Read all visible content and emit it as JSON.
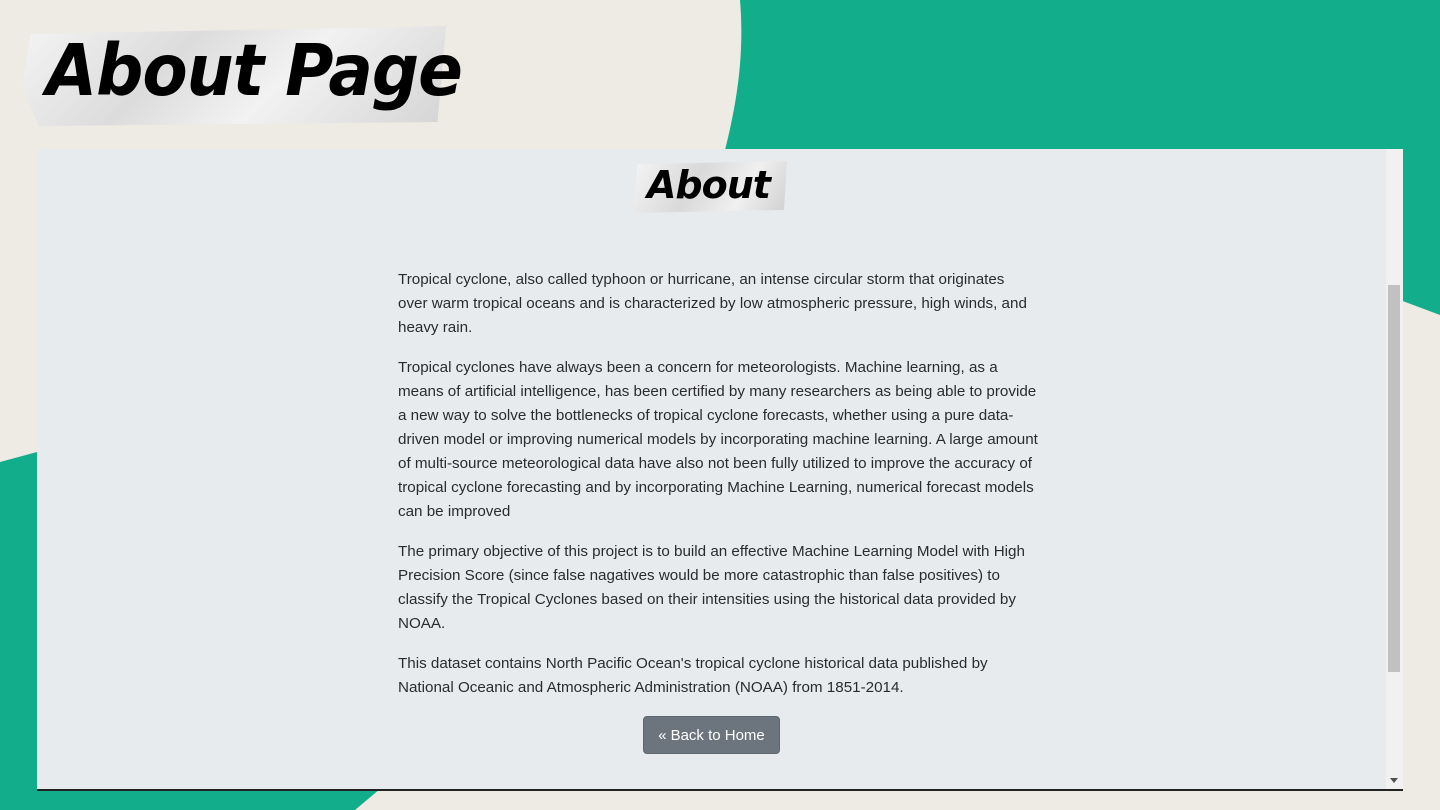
{
  "page": {
    "title": "About Page",
    "colors": {
      "accent_green": "#12ad8a",
      "background": "#eeebe4",
      "panel": "#e8ebee",
      "button": "#6c757d"
    }
  },
  "section": {
    "heading": "About"
  },
  "content": {
    "paragraphs": [
      "Tropical cyclone, also called typhoon or hurricane, an intense circular storm that originates over warm tropical oceans and is characterized by low atmospheric pressure, high winds, and heavy rain.",
      "Tropical cyclones have always been a concern for meteorologists. Machine learning, as a means of artificial intelligence, has been certified by many researchers as being able to provide a new way to solve the bottlenecks of tropical cyclone forecasts, whether using a pure data-driven model or improving numerical models by incorporating machine learning. A large amount of multi-source meteorological data have also not been fully utilized to improve the accuracy of tropical cyclone forecasting and by incorporating Machine Learning, numerical forecast models can be improved",
      "The primary objective of this project is to build an effective Machine Learning Model with High Precision Score (since false nagatives would be more catastrophic than false positives) to classify the Tropical Cyclones based on their intensities using the historical data provided by NOAA.",
      "This dataset contains North Pacific Ocean's tropical cyclone historical data published by National Oceanic and Atmospheric Administration (NOAA) from 1851-2014."
    ]
  },
  "actions": {
    "back_icon": "«",
    "back_label": "Back to Home"
  }
}
